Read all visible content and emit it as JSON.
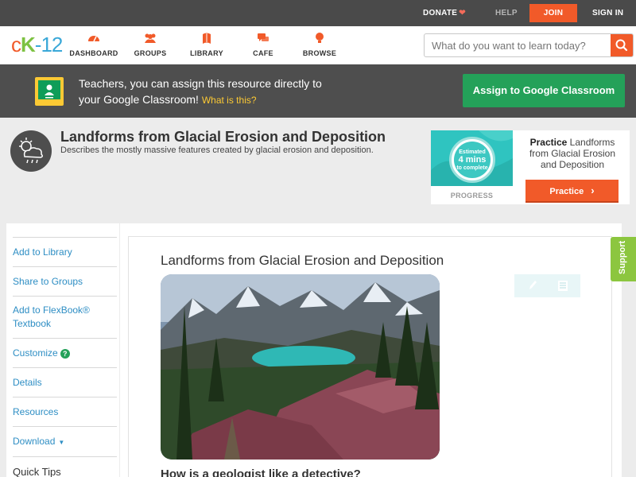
{
  "topbar": {
    "donate": "DONATE",
    "help": "HELP",
    "join": "JOIN",
    "signin": "SIGN IN"
  },
  "nav": {
    "logo_c": "c",
    "logo_k": "K",
    "logo_12": "-12",
    "items": [
      {
        "label": "DASHBOARD",
        "icon": "dashboard-icon"
      },
      {
        "label": "GROUPS",
        "icon": "groups-icon"
      },
      {
        "label": "LIBRARY",
        "icon": "library-icon"
      },
      {
        "label": "CAFE",
        "icon": "cafe-icon"
      },
      {
        "label": "BROWSE",
        "icon": "browse-icon"
      }
    ],
    "search_placeholder": "What do you want to learn today?"
  },
  "classroom": {
    "line1": "Teachers, you can assign this resource directly to",
    "line2": "your Google Classroom!",
    "what_link": "What is this?",
    "assign_button": "Assign to Google Classroom"
  },
  "concept": {
    "title": "Landforms from Glacial Erosion and Deposition",
    "description": "Describes the mostly massive features created by glacial erosion and deposition."
  },
  "practice": {
    "estimated": "Estimated",
    "mins": "4 mins",
    "to_complete": "to complete",
    "progress_label": "PROGRESS",
    "heading_bold": "Practice",
    "heading_rest": "Landforms from Glacial Erosion and Deposition",
    "button": "Practice"
  },
  "sidebar": {
    "items": [
      {
        "label": "Add to Library"
      },
      {
        "label": "Share to Groups"
      },
      {
        "label": "Add to FlexBook® Textbook"
      },
      {
        "label": "Customize"
      },
      {
        "label": "Details"
      },
      {
        "label": "Resources"
      },
      {
        "label": "Download"
      },
      {
        "label": "Quick Tips"
      }
    ]
  },
  "article": {
    "title": "Landforms from Glacial Erosion and Deposition",
    "question": "How is a geologist like a detective?"
  },
  "support": "Support",
  "colors": {
    "accent_orange": "#f15a29",
    "green": "#24a159",
    "link_blue": "#2e8ec4"
  }
}
